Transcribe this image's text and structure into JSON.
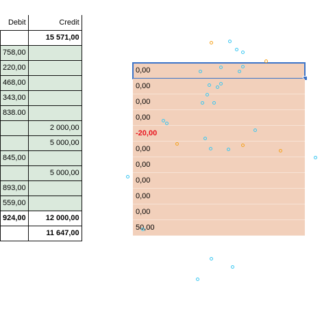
{
  "ledger": {
    "headers": {
      "debit": "Debit",
      "credit": "Credit"
    },
    "rows": [
      {
        "debit": "",
        "credit": "15 571,00",
        "debit_bold": false,
        "credit_bold": true,
        "green": false
      },
      {
        "debit": "758,00",
        "credit": "",
        "green": true
      },
      {
        "debit": "220,00",
        "credit": "",
        "green": true
      },
      {
        "debit": "468,00",
        "credit": "",
        "green": true
      },
      {
        "debit": "343,00",
        "credit": "",
        "green": true
      },
      {
        "debit": "838.00",
        "credit": "",
        "green": true
      },
      {
        "debit": "",
        "credit": "2 000,00",
        "green": true
      },
      {
        "debit": "",
        "credit": "5 000,00",
        "green": true
      },
      {
        "debit": "845,00",
        "credit": "",
        "green": true
      },
      {
        "debit": "",
        "credit": "5 000,00",
        "green": true
      },
      {
        "debit": "893,00",
        "credit": "",
        "green": true
      },
      {
        "debit": "559,00",
        "credit": "",
        "green": true
      },
      {
        "debit": "924,00",
        "credit": "12 000,00",
        "debit_bold": true,
        "credit_bold": true,
        "green": false
      },
      {
        "debit": "",
        "credit": "11 647,00",
        "credit_bold": true,
        "green": false
      }
    ]
  },
  "values": [
    "0,00",
    "0,00",
    "0,00",
    "0,00",
    "-20,00",
    "0,00",
    "0,00",
    "0,00",
    "0,00",
    "0,00",
    "50,00"
  ],
  "colors": {
    "green_fill": "#dae9dc",
    "orange_fill": "#f2d0bb",
    "negative": "#e8141e",
    "selection": "#3b73c8"
  }
}
